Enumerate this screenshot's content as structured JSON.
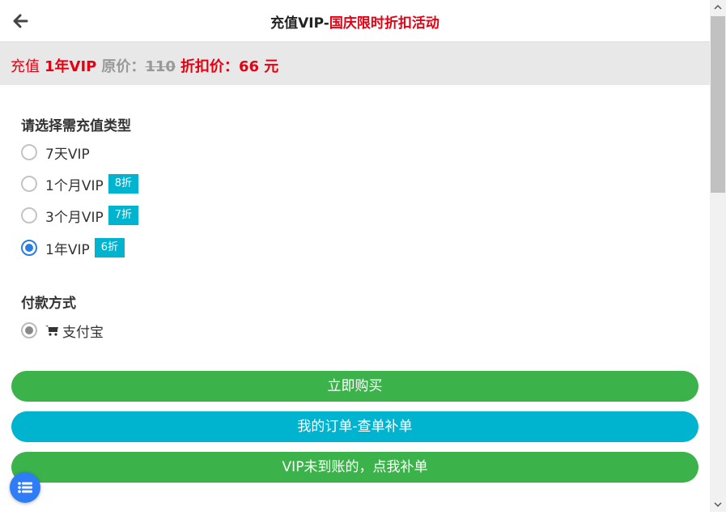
{
  "header": {
    "title_black": "充值VIP-",
    "title_red": "国庆限时折扣活动"
  },
  "banner": {
    "prefix": "充值",
    "item": "1年VIP",
    "original_label": "原价：",
    "original_price": "110",
    "discount_label": "折扣价：",
    "discount_price": "66 元"
  },
  "recharge": {
    "title": "请选择需充值类型",
    "options": [
      {
        "label": "7天VIP",
        "badge": "",
        "selected": false
      },
      {
        "label": "1个月VIP",
        "badge": "8折",
        "selected": false
      },
      {
        "label": "3个月VIP",
        "badge": "7折",
        "selected": false
      },
      {
        "label": "1年VIP",
        "badge": "6折",
        "selected": true
      }
    ]
  },
  "payment": {
    "title": "付款方式",
    "method": "支付宝",
    "icon": "cart-icon"
  },
  "buttons": {
    "buy": "立即购买",
    "orders": "我的订单-查单补单",
    "missing": "VIP未到账的，点我补单"
  },
  "colors": {
    "accent_red": "#e60012",
    "green": "#3bb34a",
    "cyan": "#00b4cf",
    "blue": "#2f7df6",
    "radio_checked": "#2b7de1"
  }
}
